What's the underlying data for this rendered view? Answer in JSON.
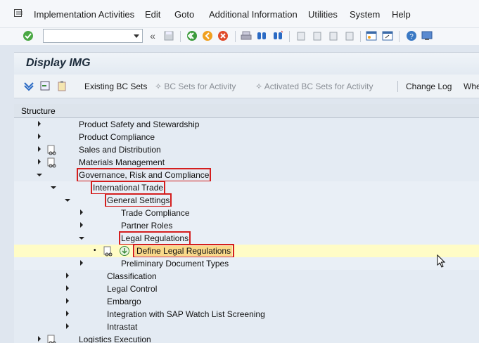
{
  "menu": {
    "items": [
      "Implementation Activities",
      "Edit",
      "Goto",
      "Additional Information",
      "Utilities",
      "System",
      "Help"
    ]
  },
  "toolbar": {
    "command_field_value": "",
    "icons": [
      "enter-icon",
      "back-icon",
      "exit-icon",
      "cancel-icon",
      "print-icon",
      "find-icon",
      "find-next-icon",
      "first-page-icon",
      "prev-page-icon",
      "next-page-icon",
      "last-page-icon",
      "create-session-icon",
      "shortcut-icon",
      "help-icon",
      "customize-layout-icon"
    ]
  },
  "title": "Display IMG",
  "app_toolbar": {
    "existing_bc_sets": "Existing BC Sets",
    "bc_sets_for_activity": "BC Sets for Activity",
    "activated_bc_sets": "Activated BC Sets for Activity",
    "change_log": "Change Log",
    "truncated": "Whe"
  },
  "tree": {
    "header": "Structure",
    "rows": [
      {
        "label": "Product Safety and Stewardship"
      },
      {
        "label": "Product Compliance"
      },
      {
        "label": "Sales and Distribution"
      },
      {
        "label": "Materials Management"
      },
      {
        "label": "Governance, Risk and Compliance"
      },
      {
        "label": "International Trade"
      },
      {
        "label": "General Settings"
      },
      {
        "label": "Trade Compliance"
      },
      {
        "label": "Partner Roles"
      },
      {
        "label": "Legal Regulations"
      },
      {
        "label": "Define Legal Regulations"
      },
      {
        "label": "Preliminary Document Types"
      },
      {
        "label": "Classification"
      },
      {
        "label": "Legal Control"
      },
      {
        "label": "Embargo"
      },
      {
        "label": "Integration with SAP Watch List Screening"
      },
      {
        "label": "Intrastat"
      },
      {
        "label": "Logistics Execution"
      }
    ]
  },
  "colors": {
    "highlight_border": "#d41e1e",
    "selected_row": "#fffcc6"
  }
}
